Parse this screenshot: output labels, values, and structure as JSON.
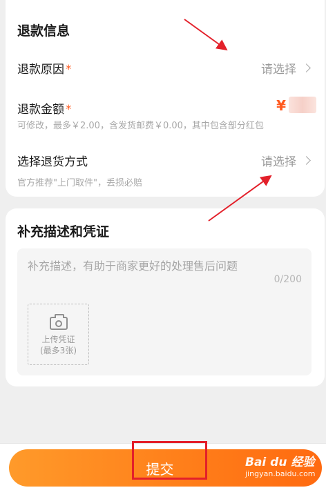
{
  "refund_info": {
    "title": "退款信息",
    "reason_label": "退款原因",
    "reason_value": "请选择",
    "amount_label": "退款金额",
    "amount_currency": "¥",
    "amount_hint": "可修改，最多￥2.00，含发货邮费￥0.00，其中包含部分红包",
    "return_method_label": "选择退货方式",
    "return_method_value": "请选择",
    "return_method_hint": "官方推荐\"上门取件\"，丢损必赔",
    "required_mark": "*"
  },
  "evidence": {
    "title": "补充描述和凭证",
    "description_placeholder": "补充描述，有助于商家更好的处理售后问题",
    "counter": "0/200",
    "upload_label_line1": "上传凭证",
    "upload_label_line2": "(最多3张)"
  },
  "footer": {
    "submit_label": "提交"
  },
  "watermark": {
    "main": "Bai du 经验",
    "sub": "jingyan.baidu.com"
  },
  "colors": {
    "accent": "#ff5a1f",
    "button_gradient_start": "#ff9a2a",
    "button_gradient_end": "#ff6a10",
    "annotation_red": "#e3202a"
  }
}
